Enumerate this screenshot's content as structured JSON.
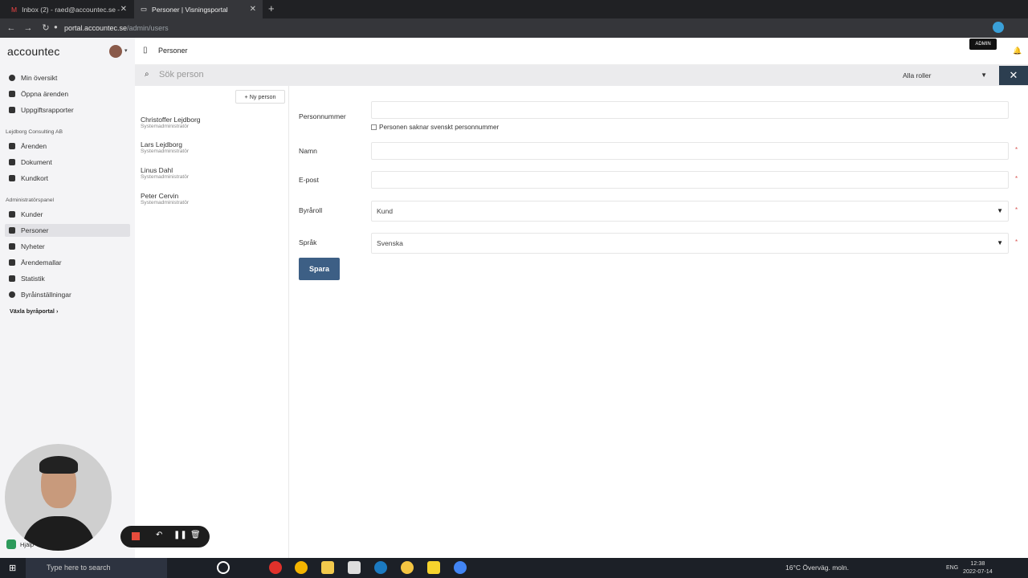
{
  "browser": {
    "tabs": [
      {
        "title": "Inbox (2) - raed@accountec.se -"
      },
      {
        "title": "Personer | Visningsportal"
      }
    ],
    "url_host": "portal.accountec.se",
    "url_path": "/admin/users"
  },
  "sidebar": {
    "brand": "accountec",
    "top_items": [
      {
        "label": "Min översikt"
      },
      {
        "label": "Öppna ärenden"
      },
      {
        "label": "Uppgiftsrapporter"
      }
    ],
    "section1": "Lejdborg Consulting AB",
    "section1_items": [
      {
        "label": "Ärenden"
      },
      {
        "label": "Dokument"
      },
      {
        "label": "Kundkort"
      }
    ],
    "section2": "Administratörspanel",
    "section2_items": [
      {
        "label": "Kunder"
      },
      {
        "label": "Personer"
      },
      {
        "label": "Nyheter"
      },
      {
        "label": "Ärendemallar"
      },
      {
        "label": "Statistik"
      },
      {
        "label": "Byråinställningar"
      }
    ],
    "switch_portal": "Växla byråportal",
    "help": "Hjälp"
  },
  "header": {
    "title": "Personer",
    "admin_badge": "ADMIN"
  },
  "search": {
    "placeholder": "Sök person",
    "role_filter": "Alla roller"
  },
  "people": {
    "new_button": "+ Ny person",
    "items": [
      {
        "name": "Christoffer Lejdborg",
        "role": "Systemadministratör"
      },
      {
        "name": "Lars Lejdborg",
        "role": "Systemadministratör"
      },
      {
        "name": "Linus Dahl",
        "role": "Systemadministratör"
      },
      {
        "name": "Peter Cervin",
        "role": "Systemadministratör"
      }
    ]
  },
  "form": {
    "personnummer_label": "Personnummer",
    "personnummer_value": "",
    "no_ssn_checkbox": "Personen saknar svenskt personnummer",
    "name_label": "Namn",
    "name_value": "",
    "email_label": "E-post",
    "email_value": "",
    "role_label": "Byråroll",
    "role_value": "Kund",
    "language_label": "Språk",
    "language_value": "Svenska",
    "save_button": "Spara"
  },
  "taskbar": {
    "search_placeholder": "Type here to search",
    "weather": "16°C  Överväg. moln.",
    "lang": "ENG",
    "time": "12:38",
    "date": "2022-07-14"
  },
  "colors": {
    "primary": "#3d5f85",
    "tool_button": "#2c3e50",
    "required": "#d9534f"
  }
}
